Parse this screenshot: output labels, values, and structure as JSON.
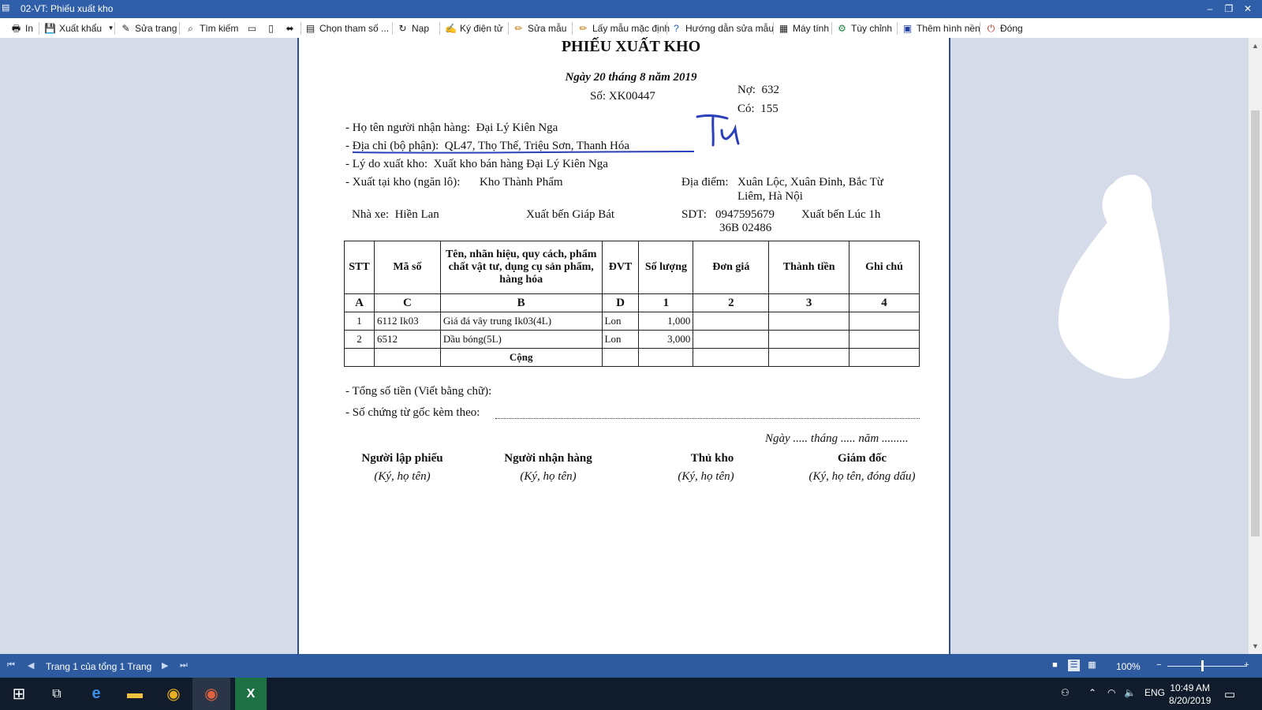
{
  "window": {
    "title": "02-VT: Phiếu xuất kho",
    "app_icon": "document-icon",
    "controls": [
      "minimize-icon",
      "restore-icon",
      "close-icon"
    ]
  },
  "toolbar": {
    "in": "In",
    "xuat_khau": "Xuất khẩu",
    "sua_trang": "Sửa trang",
    "tim_kiem": "Tìm kiếm",
    "chon_tham_so": "Chọn tham số ...",
    "nap": "Nạp",
    "ky_dien_tu": "Ký điện tử",
    "sua_mau": "Sửa mẫu",
    "lay_mau_mac_dinh": "Lấy mẫu mặc định",
    "huong_dan_sua_mau": "Hướng dẫn sửa mẫu",
    "may_tinh": "Máy tính",
    "tuy_chinh": "Tùy chỉnh",
    "them_hinh_nen": "Thêm hình nền",
    "dong": "Đóng"
  },
  "document": {
    "title": "PHIẾU XUẤT KHO",
    "date_line": "Ngày 20 tháng 8 năm 2019",
    "so_label": "Số:",
    "so_value": "XK00447",
    "no_label": "Nợ:",
    "no_value": "632",
    "co_label": "Có:",
    "co_value": "155",
    "nguoi_nhan_label": "- Họ tên người nhận hàng:",
    "nguoi_nhan_value": "Đại Lý Kiên Nga",
    "dia_chi_label": "- Địa chỉ (bộ phận):",
    "dia_chi_value": "QL47, Thọ Thế, Triệu Sơn, Thanh Hóa",
    "ly_do_label": "- Lý do xuất kho:",
    "ly_do_value": "Xuất kho bán hàng Đại Lý Kiên Nga",
    "xuat_tai_kho_label": "- Xuất tại kho (ngăn lô):",
    "xuat_tai_kho_value": "Kho Thành Phẩm",
    "dia_diem_label": "Địa điểm:",
    "dia_diem_line1": "Xuân Lộc, Xuân Đỉnh, Bắc Từ",
    "dia_diem_line2": "Liêm, Hà Nội",
    "nha_xe_label": "Nhà xe:",
    "nha_xe_value": "Hiền Lan",
    "xuat_ben": "Xuất bến Giáp Bát",
    "sdt_label": "SDT:",
    "sdt_value": "0947595679",
    "xuat_ben_luc": "Xuất bến Lúc 1h",
    "bien_so": "36B 02486",
    "table": {
      "headers": [
        "STT",
        "Mã số",
        "Tên, nhãn hiệu, quy cách, phẩm chất vật tư, dụng cụ sản phẩm, hàng hóa",
        "ĐVT",
        "Số lượng",
        "Đơn giá",
        "Thành tiền",
        "Ghi chú"
      ],
      "codes": [
        "A",
        "C",
        "B",
        "D",
        "1",
        "2",
        "3",
        "4"
      ],
      "rows": [
        {
          "stt": "1",
          "ma_so": "6112 Ik03",
          "ten": "Giá đá vây trung Ik03(4L)",
          "dvt": "Lon",
          "so_luong": "1,000",
          "don_gia": "",
          "thanh_tien": "",
          "ghi_chu": ""
        },
        {
          "stt": "2",
          "ma_so": "6512",
          "ten": "Dầu bóng(5L)",
          "dvt": "Lon",
          "so_luong": "3,000",
          "don_gia": "",
          "thanh_tien": "",
          "ghi_chu": ""
        }
      ],
      "total_label": "Cộng"
    },
    "tong_so_tien": "- Tổng số tiền (Viết bằng chữ):",
    "so_chung_tu": "- Số chứng từ gốc kèm theo:",
    "sign_date": "Ngày ..... tháng ..... năm .........",
    "signers": [
      {
        "role": "Người lập phiếu",
        "note": "(Ký, họ tên)"
      },
      {
        "role": "Người nhận hàng",
        "note": "(Ký, họ tên)"
      },
      {
        "role": "Thủ kho",
        "note": "(Ký, họ tên)"
      },
      {
        "role": "Giám đốc",
        "note": "(Ký, họ tên, đóng dấu)"
      }
    ]
  },
  "statusbar": {
    "page_info": "Trang 1 của tổng 1 Trang",
    "zoom": "100%"
  },
  "taskbar": {
    "apps": [
      "windows-start-icon",
      "task-view-icon",
      "edge-icon",
      "file-explorer-icon",
      "chrome-icon",
      "chrome-canary-icon",
      "excel-icon"
    ],
    "language": "ENG",
    "time": "10:49 AM",
    "date": "8/20/2019"
  },
  "colors": {
    "titlebar": "#2f5fa8",
    "statusbar": "#2e5ba0",
    "taskbar": "#101b2c",
    "annotation_ink": "#2a3fb8"
  }
}
